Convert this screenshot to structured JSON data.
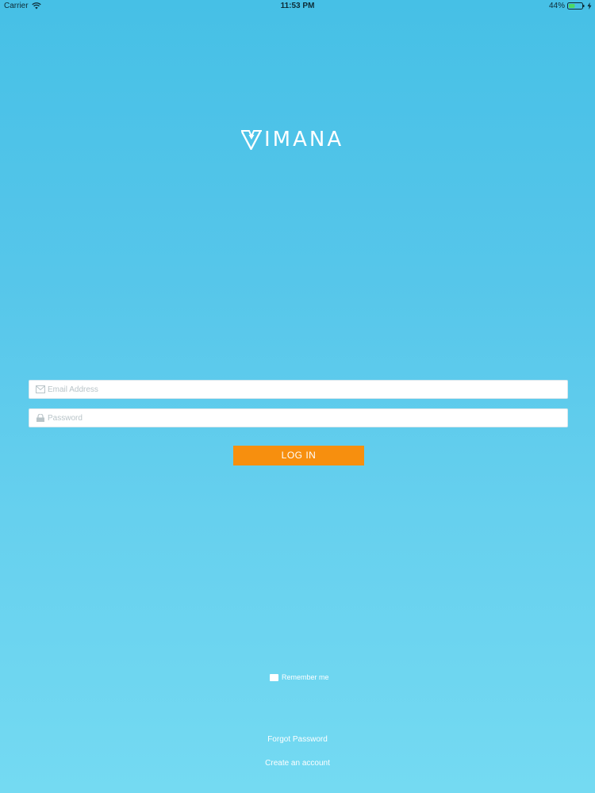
{
  "status_bar": {
    "carrier": "Carrier",
    "time": "11:53 PM",
    "battery": "44%",
    "icons": [
      "wifi-icon",
      "battery-icon",
      "charging-bolt-icon"
    ]
  },
  "logo": {
    "text": "IMANA",
    "mark_icon": "vimana-v-mark-icon"
  },
  "form": {
    "email": {
      "placeholder": "Email Address",
      "value": "",
      "icon": "envelope-icon"
    },
    "password": {
      "placeholder": "Password",
      "value": "",
      "icon": "lock-icon"
    },
    "login_label": "LOG IN"
  },
  "remember": {
    "label": "Remember me",
    "checked": false
  },
  "links": {
    "forgot_password": "Forgot Password",
    "create_account": "Create an account"
  },
  "colors": {
    "background_top": "#46c0e6",
    "background_bottom": "#74daf2",
    "button": "#f78f0e",
    "text": "#ffffff"
  }
}
